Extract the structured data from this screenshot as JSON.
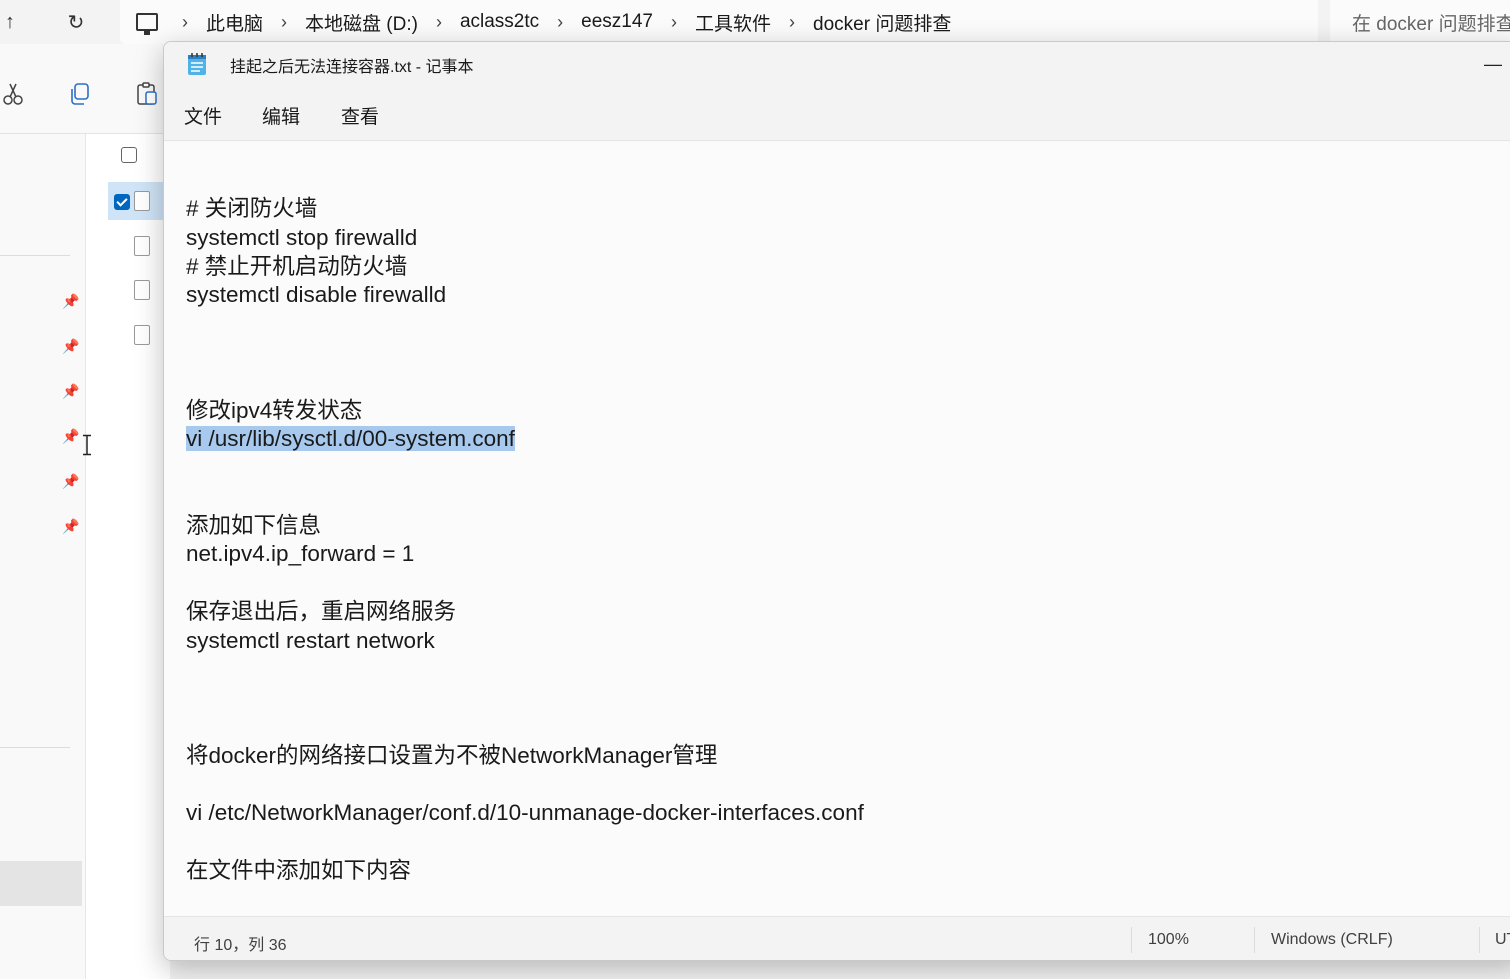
{
  "explorer": {
    "nav": {
      "up_glyph": "↑",
      "refresh_glyph": "↻"
    },
    "breadcrumb": [
      "此电脑",
      "本地磁盘 (D:)",
      "aclass2tc",
      "eesz147",
      "工具软件",
      "docker 问题排查"
    ],
    "breadcrumb_separator": "›",
    "search_placeholder": "在 docker 问题排查",
    "toolbar_icons": [
      "cut-icon",
      "copy-icon",
      "paste-icon"
    ],
    "pin_glyph": "📌"
  },
  "notepad": {
    "title": "挂起之后无法连接容器.txt - 记事本",
    "minimize_glyph": "—",
    "menu": [
      "文件",
      "编辑",
      "查看"
    ],
    "lines": [
      "# 关闭防火墙",
      "systemctl stop firewalld",
      "# 禁止开机启动防火墙",
      "systemctl disable firewalld",
      "修改ipv4转发状态",
      "vi /usr/lib/sysctl.d/00-system.conf",
      "添加如下信息",
      "net.ipv4.ip_forward = 1",
      "保存退出后，重启网络服务",
      "systemctl restart network",
      "将docker的网络接口设置为不被NetworkManager管理",
      "vi /etc/NetworkManager/conf.d/10-unmanage-docker-interfaces.conf",
      "在文件中添加如下内容"
    ],
    "selected_line_index": 5,
    "status": {
      "position": "行 10，列 36",
      "zoom": "100%",
      "line_ending": "Windows (CRLF)",
      "encoding": "UT"
    }
  },
  "colors": {
    "selection": "#a7c9ee",
    "accent": "#0067c0"
  }
}
